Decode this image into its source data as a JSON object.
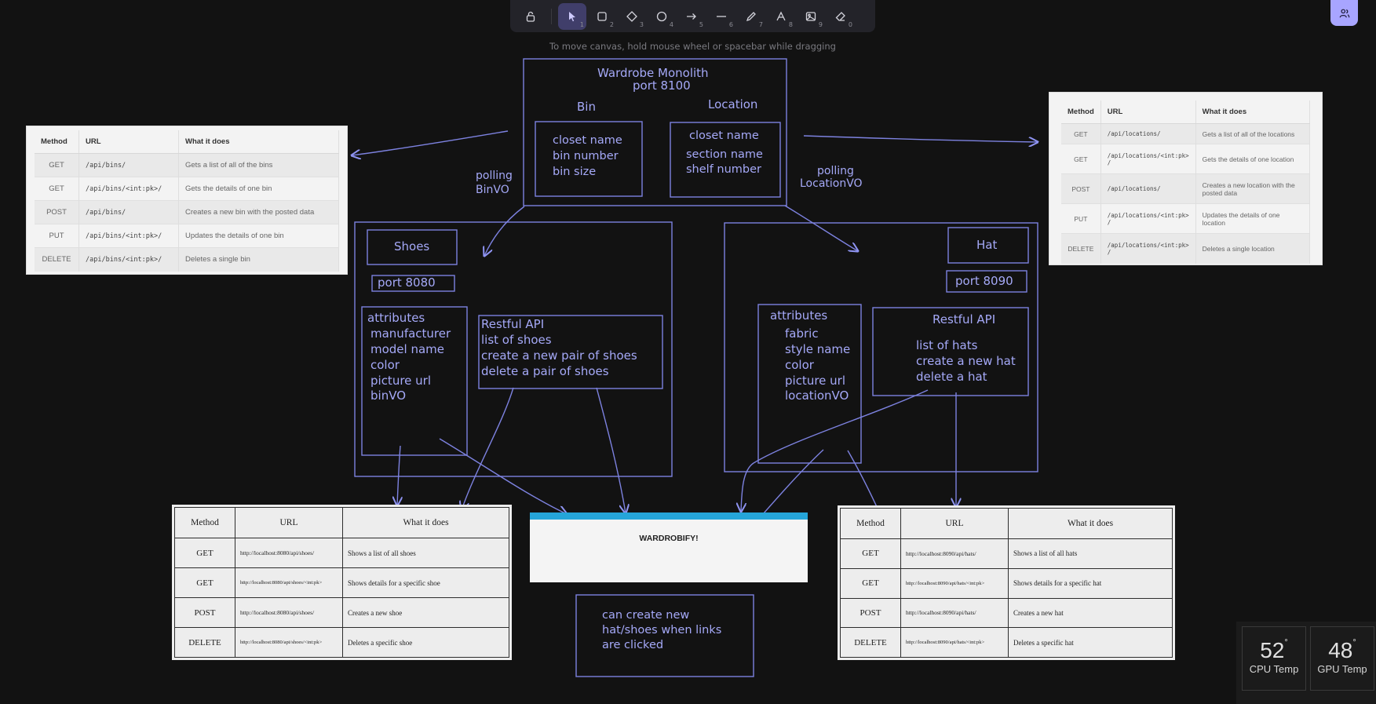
{
  "toolbar": {
    "tools": [
      {
        "name": "selection",
        "num": "1"
      },
      {
        "name": "rectangle",
        "num": "2"
      },
      {
        "name": "diamond",
        "num": "3"
      },
      {
        "name": "ellipse",
        "num": "4"
      },
      {
        "name": "arrow",
        "num": "5"
      },
      {
        "name": "line",
        "num": "6"
      },
      {
        "name": "draw",
        "num": "7"
      },
      {
        "name": "text",
        "num": "8"
      },
      {
        "name": "image",
        "num": "9"
      },
      {
        "name": "eraser",
        "num": "0"
      }
    ],
    "hint": "To move canvas, hold mouse wheel or spacebar while dragging"
  },
  "monolith": {
    "title": "Wardrobe Monolith",
    "port": "port 8100",
    "bin_label": "Bin",
    "location_label": "Location",
    "bin_fields": [
      "closet name",
      "bin number",
      "bin size"
    ],
    "location_fields": [
      "closet name",
      "section name",
      "shelf number"
    ]
  },
  "polling": {
    "bin": [
      "polling",
      "BinVO"
    ],
    "location": [
      "polling",
      "LocationVO"
    ]
  },
  "shoes": {
    "title": "Shoes",
    "port": "port 8080",
    "attributes": [
      "attributes",
      "manufacturer",
      "model name",
      "color",
      "picture url",
      "binVO"
    ],
    "api": [
      "Restful API",
      "list of shoes",
      "create a new pair of shoes",
      "delete a pair of shoes"
    ]
  },
  "hat": {
    "title": "Hat",
    "port": "port 8090",
    "attributes": [
      "attributes",
      "fabric",
      "style name",
      "color",
      "picture url",
      "locationVO"
    ],
    "api_title": "Restful API",
    "api": [
      "list of hats",
      "create a new hat",
      "delete a hat"
    ]
  },
  "note": [
    "can create new",
    "hat/shoes when links",
    "are clicked"
  ],
  "bins_table": {
    "headers": [
      "Method",
      "URL",
      "What it does"
    ],
    "rows": [
      [
        "GET",
        "/api/bins/",
        "Gets a list of all of the bins"
      ],
      [
        "GET",
        "/api/bins/<int:pk>/",
        "Gets the details of one bin"
      ],
      [
        "POST",
        "/api/bins/",
        "Creates a new bin with the posted data"
      ],
      [
        "PUT",
        "/api/bins/<int:pk>/",
        "Updates the details of one bin"
      ],
      [
        "DELETE",
        "/api/bins/<int:pk>/",
        "Deletes a single bin"
      ]
    ]
  },
  "locations_table": {
    "headers": [
      "Method",
      "URL",
      "What it does"
    ],
    "rows": [
      [
        "GET",
        "/api/locations/",
        "Gets a list of all of the locations"
      ],
      [
        "GET",
        "/api/locations/<int:pk>\n/",
        "Gets the details of one location"
      ],
      [
        "POST",
        "/api/locations/",
        "Creates a new location with the posted data"
      ],
      [
        "PUT",
        "/api/locations/<int:pk>\n/",
        "Updates the details of one location"
      ],
      [
        "DELETE",
        "/api/locations/<int:pk>\n/",
        "Deletes a single location"
      ]
    ]
  },
  "shoes_table": {
    "headers": [
      "Method",
      "URL",
      "What it does"
    ],
    "rows": [
      [
        "GET",
        "http://localhost:8080/api/shoes/",
        "Shows a list of all shoes"
      ],
      [
        "GET",
        "http://localhost:8080/api/shoes/<int:pk>",
        "Shows details for a specific shoe"
      ],
      [
        "POST",
        "http://localhost:8080/api/shoes/",
        "Creates a new shoe"
      ],
      [
        "DELETE",
        "http://localhost:8080/api/shoes/<int:pk>",
        "Deletes a specific shoe"
      ]
    ]
  },
  "hats_table": {
    "headers": [
      "Method",
      "URL",
      "What it does"
    ],
    "rows": [
      [
        "GET",
        "http://localhost:8090/api/hats/",
        "Shows a list of all hats"
      ],
      [
        "GET",
        "http://localhost:8090/api/hats/<int:pk>",
        "Shows details for a specific hat"
      ],
      [
        "POST",
        "http://localhost:8090/api/hats/",
        "Creates a new hat"
      ],
      [
        "DELETE",
        "http://localhost:8090/api/hats/<int:pk>",
        "Deletes a specific hat"
      ]
    ]
  },
  "preview": {
    "title": "WARDROBIFY!"
  },
  "temps": {
    "cpu_value": "52",
    "cpu_label": "CPU Temp",
    "gpu_value": "48",
    "gpu_label": "GPU Temp",
    "degree": "°"
  },
  "colors": {
    "background": "#121212",
    "sketch": "#8f94f2",
    "toolbar": "#232329",
    "active_tool": "#403e6a",
    "collab_button": "#a8a5ff"
  }
}
